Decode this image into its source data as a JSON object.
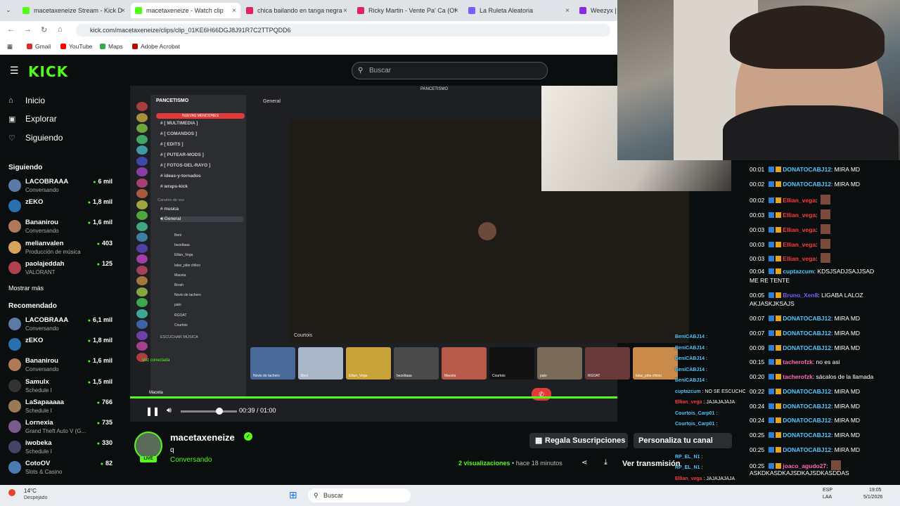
{
  "browser": {
    "tabs": [
      {
        "title": "macetaxeneize Stream - Kick D",
        "color": "#53fc18"
      },
      {
        "title": "macetaxeneize - Watch clip",
        "color": "#53fc18",
        "active": true
      },
      {
        "title": "chica bailando en tanga negra",
        "color": "#e0245e"
      },
      {
        "title": "Ricky Martin - Vente Pa' Ca (Of",
        "color": "#e0245e"
      },
      {
        "title": "La Ruleta Aleatoria",
        "color": "#7b5cff"
      },
      {
        "title": "Weezyx | In",
        "color": "#8a2be2"
      }
    ],
    "url": "kick.com/macetaxeneize/clips/clip_01KE6H66DGJ8J91R7C2TTPQDD6",
    "bookmarks": [
      "Gmail",
      "YouTube",
      "Maps",
      "Adobe Acrobat"
    ]
  },
  "header": {
    "logo": "KICK",
    "search_placeholder": "Buscar"
  },
  "sidebar": {
    "nav": [
      {
        "label": "Inicio",
        "icon": "home-icon",
        "glyph": "⌂"
      },
      {
        "label": "Explorar",
        "icon": "compass-icon",
        "glyph": "▣"
      },
      {
        "label": "Siguiendo",
        "icon": "heart-icon",
        "glyph": "♡"
      }
    ],
    "following_title": "Siguiendo",
    "following": [
      {
        "name": "LACOBRAAA",
        "sub": "Conversando",
        "viewers": "6 mil",
        "color": "#5b7aa8"
      },
      {
        "name": "zEKO",
        "sub": "",
        "viewers": "1,8 mil",
        "color": "#2a6fb0"
      },
      {
        "name": "Bananirou",
        "sub": "Conversando",
        "viewers": "1,6 mil",
        "color": "#b07a5a"
      },
      {
        "name": "melianvalen",
        "sub": "Producción de música",
        "viewers": "403",
        "color": "#d9a55b"
      },
      {
        "name": "paolajeddah",
        "sub": "VALORANT",
        "viewers": "125",
        "color": "#b04050"
      }
    ],
    "show_more": "Mostrar más",
    "recommended_title": "Recomendado",
    "recommended": [
      {
        "name": "LACOBRAAA",
        "sub": "Conversando",
        "viewers": "6,1 mil",
        "color": "#5b7aa8"
      },
      {
        "name": "zEKO",
        "sub": "",
        "viewers": "1,8 mil",
        "color": "#2a6fb0"
      },
      {
        "name": "Bananirou",
        "sub": "Conversando",
        "viewers": "1,6 mil",
        "color": "#b07a5a"
      },
      {
        "name": "Samulx",
        "sub": "Schedule I",
        "viewers": "1,5 mil",
        "color": "#333333"
      },
      {
        "name": "LaSapaaaaa",
        "sub": "Schedule I",
        "viewers": "766",
        "color": "#9a7a55"
      },
      {
        "name": "Lornexia",
        "sub": "Grand Theft Auto V (G...",
        "viewers": "735",
        "color": "#7a5a8a"
      },
      {
        "name": "iwobeka",
        "sub": "Schedule I",
        "viewers": "330",
        "color": "#444466"
      },
      {
        "name": "CotoOV",
        "sub": "Slots & Casino",
        "viewers": "82",
        "color": "#4a7ab0"
      }
    ]
  },
  "discord": {
    "server_name": "PANCETISMO",
    "mentions_banner": "NUEVAS MENCIONES",
    "channel_header": "General",
    "top_label": "PANCETISMO",
    "channels": [
      "[ MULTIMEDIA ]",
      "[ COMANDOS ]",
      "[ EDITS ]",
      "[ PUTEAR-MODS ]",
      "[ FOTOS-DEL-RAYO ]",
      "ideas-y-tornados",
      "wraps-kick"
    ],
    "voice_header": "Canales de voz",
    "voice_channels": [
      "musica",
      "General"
    ],
    "members": [
      "Beni",
      "bezeltaaa",
      "Ellian_Vega",
      "lalaz_pibe chiloo",
      "Maceta",
      "Brosh",
      "Novio de tachero",
      "pato",
      "RGOAT",
      "Courtois"
    ],
    "listen": "ESCUCHAR MÚSICA",
    "stage_label": "Courtois",
    "voice_status": "Voz conectada",
    "user_name": "Maceta",
    "tiles": [
      "Novio de tachero",
      "Beni",
      "Ellian_Vega",
      "bezeltaaa",
      "Maceta",
      "Courtois",
      "pato",
      "RGOAT",
      "lalaz_pibe chiloo"
    ]
  },
  "player": {
    "progress": 1.0,
    "time": "00:39 / 01:00"
  },
  "stream": {
    "name": "macetaxeneize",
    "badge": "LIVE",
    "title": "q",
    "category": "Conversando",
    "gift_button": "Regala Suscripciones",
    "personalize_button": "Personaliza tu canal",
    "views": "2 visualizaciones",
    "ago": "hace 18 minutos",
    "watch_button": "Ver transmisión"
  },
  "chat": [
    {
      "t": "00:01",
      "u": "DONATOCABJ12",
      "m": "MIRA MD",
      "c": "#53c8ff"
    },
    {
      "t": "00:02",
      "u": "DONATOCABJ12",
      "m": "MIRA MD",
      "c": "#53c8ff"
    },
    {
      "t": "00:02",
      "u": "Ellian_vega",
      "m": "",
      "c": "#ff3b3b"
    },
    {
      "t": "00:03",
      "u": "Ellian_vega",
      "m": "",
      "c": "#ff3b3b"
    },
    {
      "t": "00:03",
      "u": "Ellian_vega",
      "m": "",
      "c": "#ff3b3b"
    },
    {
      "t": "00:03",
      "u": "Ellian_vega",
      "m": "",
      "c": "#ff3b3b"
    },
    {
      "t": "00:03",
      "u": "Ellian_vega",
      "m": "",
      "c": "#ff3b3b"
    },
    {
      "t": "00:04",
      "u": "cuptazcum",
      "m": "KDSJSADJSAJJSAD",
      "c": "#53c8ff",
      "m2": "ME RE TENTE"
    },
    {
      "t": "00:05",
      "u": "Bruno_Xen8",
      "m": "LIGABA LALOZ",
      "c": "#7b5cff",
      "m2": "AKJASKJKSAJS"
    },
    {
      "t": "00:07",
      "u": "DONATOCABJ12",
      "m": "MIRA MD",
      "c": "#53c8ff"
    },
    {
      "t": "00:07",
      "u": "DONATOCABJ12",
      "m": "MIRA MD",
      "c": "#53c8ff"
    },
    {
      "t": "00:09",
      "u": "DONATOCABJ12",
      "m": "MIRA MD",
      "c": "#53c8ff"
    },
    {
      "t": "00:15",
      "u": "tacherofzk",
      "m": "no es asi",
      "c": "#ff69b4"
    },
    {
      "t": "00:20",
      "u": "tacherofzk",
      "m": "sácalos de la llamada",
      "c": "#ff69b4"
    },
    {
      "t": "00:22",
      "u": "DONATOCABJ12",
      "m": "MIRA MD",
      "c": "#53c8ff"
    },
    {
      "t": "00:24",
      "u": "DONATOCABJ12",
      "m": "MIRA MD",
      "c": "#53c8ff"
    },
    {
      "t": "00:24",
      "u": "DONATOCABJ12",
      "m": "MIRA MD",
      "c": "#53c8ff"
    },
    {
      "t": "00:25",
      "u": "DONATOCABJ12",
      "m": "MIRA MD",
      "c": "#53c8ff"
    },
    {
      "t": "00:25",
      "u": "DONATOCABJ12",
      "m": "MIRA MD",
      "c": "#53c8ff"
    },
    {
      "t": "00:25",
      "u": "joaco_agudo27",
      "m": "",
      "c": "#ff69b4",
      "m2": "ASKDKASDKAJSDKAJSDKASDDAS"
    }
  ],
  "overlay_chat": [
    {
      "u": "BeniCABJ14",
      "m": ""
    },
    {
      "u": "BeniCABJ14",
      "m": ""
    },
    {
      "u": "BeniCABJ14",
      "m": ""
    },
    {
      "u": "BeniCABJ14",
      "m": ""
    },
    {
      "u": "BeniCABJ14",
      "m": ""
    },
    {
      "u": "cuptazcum",
      "m": "NO SE ESCUCHO NADA"
    },
    {
      "u": "Ellian_vega",
      "m": "JAJAJAJAJA"
    },
    {
      "u": "Courtois_Carp01",
      "m": ""
    },
    {
      "u": "Courtois_Carp01",
      "m": ""
    },
    {
      "u": "RP_EL_N1",
      "m": ""
    },
    {
      "u": "RP_EL_N1",
      "m": ""
    },
    {
      "u": "RP_EL_N1",
      "m": ""
    },
    {
      "u": "RP_EL_N1",
      "m": ""
    },
    {
      "u": "Ellian_vega",
      "m": "JAJAJAJAJA"
    }
  ],
  "taskbar": {
    "temp": "14°C",
    "weather": "Despejado",
    "search": "Buscar",
    "lang": "ESP",
    "lang2": "LAA",
    "time": "19:05",
    "date": "5/1/2026"
  },
  "colors": {
    "kick_green": "#53fc18"
  }
}
